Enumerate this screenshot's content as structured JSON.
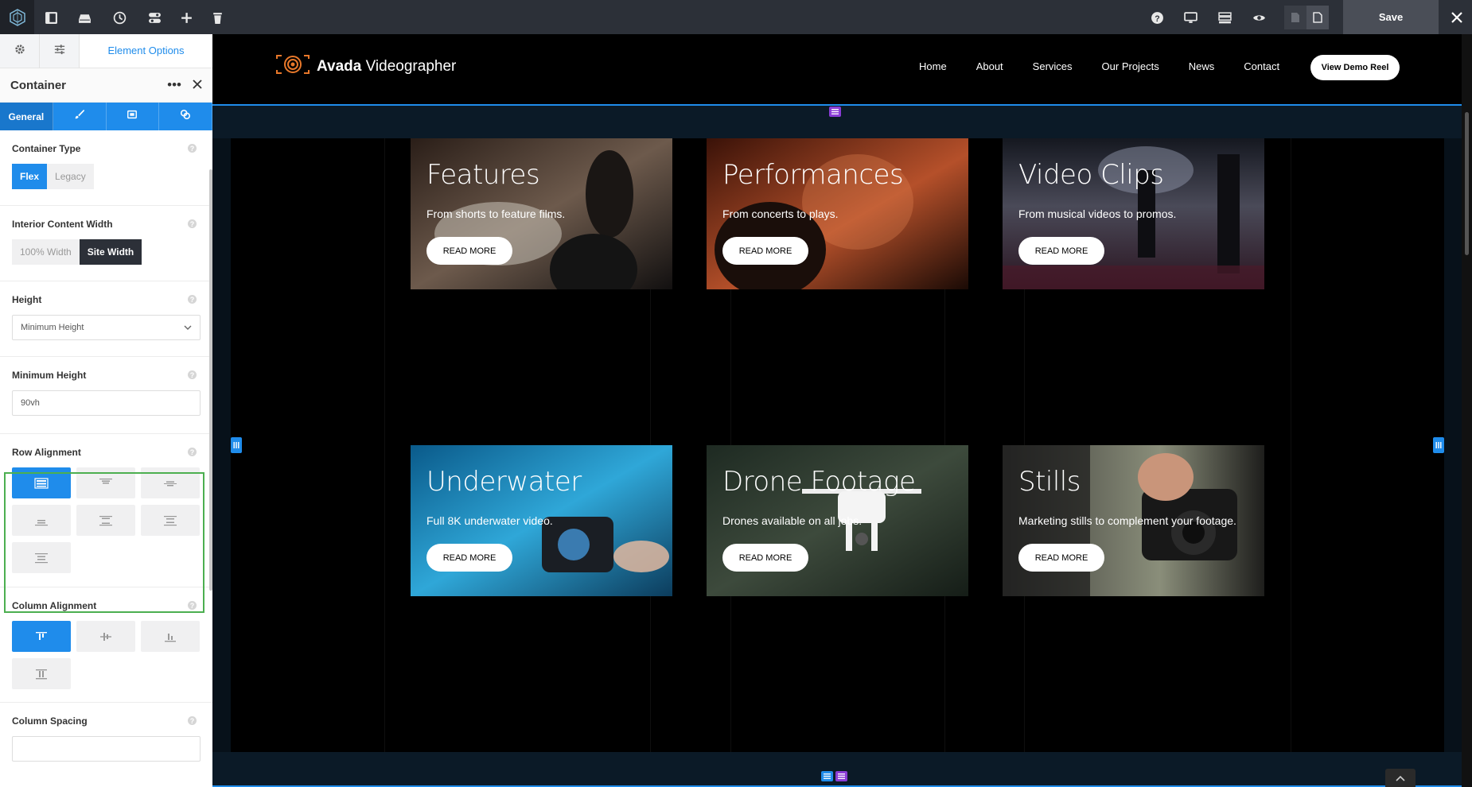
{
  "toolbar": {
    "save_label": "Save",
    "icons": [
      "layout-toggle-icon",
      "library-icon",
      "history-icon",
      "navigator-icon",
      "add-icon",
      "trash-icon",
      "help-icon",
      "desktop-icon",
      "wireframe-icon",
      "preview-icon",
      "page-off-icon",
      "page-icon",
      "close-icon"
    ]
  },
  "panel": {
    "tab_label": "Element Options",
    "title": "Container",
    "subtabs": {
      "general": "General"
    },
    "container_type": {
      "label": "Container Type",
      "options": [
        "Flex",
        "Legacy"
      ],
      "selected": "Flex"
    },
    "interior_width": {
      "label": "Interior Content Width",
      "options": [
        "100% Width",
        "Site Width"
      ],
      "selected": "Site Width"
    },
    "height": {
      "label": "Height",
      "value": "Minimum Height"
    },
    "min_height": {
      "label": "Minimum Height",
      "value": "90vh"
    },
    "row_alignment": {
      "label": "Row Alignment",
      "selected_index": 0
    },
    "column_alignment": {
      "label": "Column Alignment",
      "selected_index": 0
    },
    "column_spacing": {
      "label": "Column Spacing",
      "value": ""
    }
  },
  "site": {
    "brand_bold": "Avada",
    "brand_rest": " Videographer",
    "nav": [
      "Home",
      "About",
      "Services",
      "Our Projects",
      "News",
      "Contact"
    ],
    "cta": "View Demo Reel"
  },
  "cards": [
    {
      "title": "Features",
      "subtitle": "From shorts to feature films.",
      "button": "READ MORE",
      "colors": [
        "#2a1e18",
        "#6d5a4c",
        "#121010"
      ]
    },
    {
      "title": "Performances",
      "subtitle": "From concerts to plays.",
      "button": "READ MORE",
      "colors": [
        "#3a1208",
        "#b5502a",
        "#1a0a05"
      ]
    },
    {
      "title": "Video Clips",
      "subtitle": "From musical videos to promos.",
      "button": "READ MORE",
      "colors": [
        "#151820",
        "#4a4a58",
        "#2a1420"
      ]
    },
    {
      "title": "Underwater",
      "subtitle": "Full 8K underwater video.",
      "button": "READ MORE",
      "colors": [
        "#0a5a8a",
        "#2fa7d8",
        "#0c3c5c"
      ]
    },
    {
      "title": "Drone Footage",
      "subtitle": "Drones available on all jobs.",
      "button": "READ MORE",
      "colors": [
        "#1e2a22",
        "#3d4a3c",
        "#151d17"
      ]
    },
    {
      "title": "Stills",
      "subtitle": "Marketing stills to complement your footage.",
      "button": "READ MORE",
      "colors": [
        "#3b3b38",
        "#8a8e7a",
        "#1e1e1c"
      ]
    }
  ],
  "colors": {
    "accent": "#1f8ceb",
    "toolbar": "#2c3038",
    "handle_purple": "#8a3cd6",
    "highlight": "#4caf50",
    "brand_orange": "#e8782a"
  }
}
